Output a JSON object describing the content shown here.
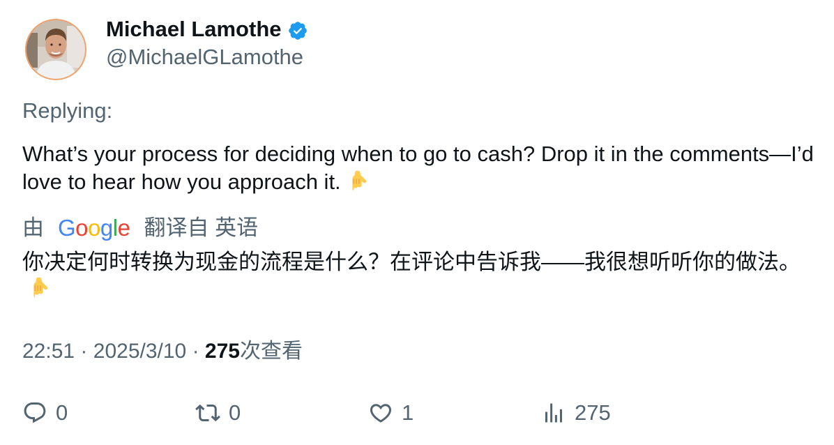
{
  "author": {
    "display_name": "Michael Lamothe",
    "handle": "@MichaelGLamothe",
    "verified_icon": "verified-badge-icon",
    "verified_color": "#1d9bf0"
  },
  "replying_label": "Replying:",
  "tweet": {
    "text": "What’s your process for deciding when to go to cash? Drop it in the comments—I’d love to hear how you approach it.",
    "emoji": "pointing-down-hand-icon"
  },
  "translation": {
    "prefix": "由",
    "provider": "Google",
    "suffix": "翻译自 英语",
    "text": "你决定何时转换为现金的流程是什么？在评论中告诉我——我很想听听你的做法。"
  },
  "meta": {
    "time": "22:51",
    "separator": "·",
    "date": "2025/3/10",
    "views_count": "275",
    "views_label": "次查看"
  },
  "actions": {
    "reply_count": "0",
    "retweet_count": "0",
    "like_count": "1",
    "views_count": "275"
  },
  "colors": {
    "text_primary": "#0f1419",
    "text_secondary": "#536471",
    "google_blue": "#4285f4",
    "google_red": "#ea4335",
    "google_yellow": "#fbbc05",
    "google_green": "#34a853"
  }
}
